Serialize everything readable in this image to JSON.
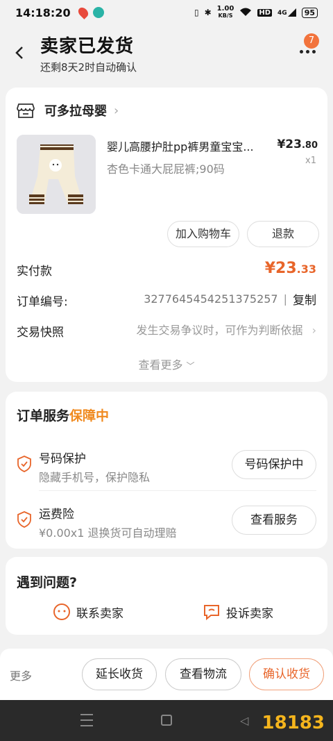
{
  "status_bar": {
    "time": "14:18:20",
    "net_speed": "1.00",
    "net_unit": "KB/S",
    "hd": "HD",
    "signal": "4G",
    "battery": "95"
  },
  "header": {
    "title": "卖家已发货",
    "subtitle": "还剩8天2时自动确认",
    "badge_count": "7"
  },
  "order": {
    "shop_name": "可多拉母婴",
    "product_title": "婴儿高腰护肚pp裤男童宝宝...",
    "product_spec": "杏色卡通大屁屁裤;90码",
    "price_currency": "¥",
    "price_int": "23",
    "price_dec": ".80",
    "qty": "x1",
    "add_cart_label": "加入购物车",
    "refund_label": "退款",
    "paid_label": "实付款",
    "paid_currency": "¥",
    "paid_int": "23",
    "paid_dec": ".33",
    "order_no_label": "订单编号:",
    "order_no": "3277645454251375257",
    "copy_label": "复制",
    "snapshot_label": "交易快照",
    "snapshot_tip": "发生交易争议时，可作为判断依据",
    "view_more": "查看更多"
  },
  "service": {
    "title": "订单服务",
    "title_highlight": "保障中",
    "items": [
      {
        "name": "号码保护",
        "desc": "隐藏手机号，保护隐私",
        "button": "号码保护中"
      },
      {
        "name": "运费险",
        "desc": "¥0.00x1  退换货可自动理赔",
        "button": "查看服务"
      }
    ]
  },
  "problem": {
    "title": "遇到问题?",
    "contact_seller": "联系卖家",
    "complain_seller": "投诉卖家"
  },
  "bottom_bar": {
    "more": "更多",
    "extend": "延长收货",
    "logistics": "查看物流",
    "confirm": "确认收货"
  },
  "watermark": "18183",
  "colors": {
    "accent": "#e8652a",
    "highlight": "#f08a1f",
    "badge": "#f2733c"
  }
}
